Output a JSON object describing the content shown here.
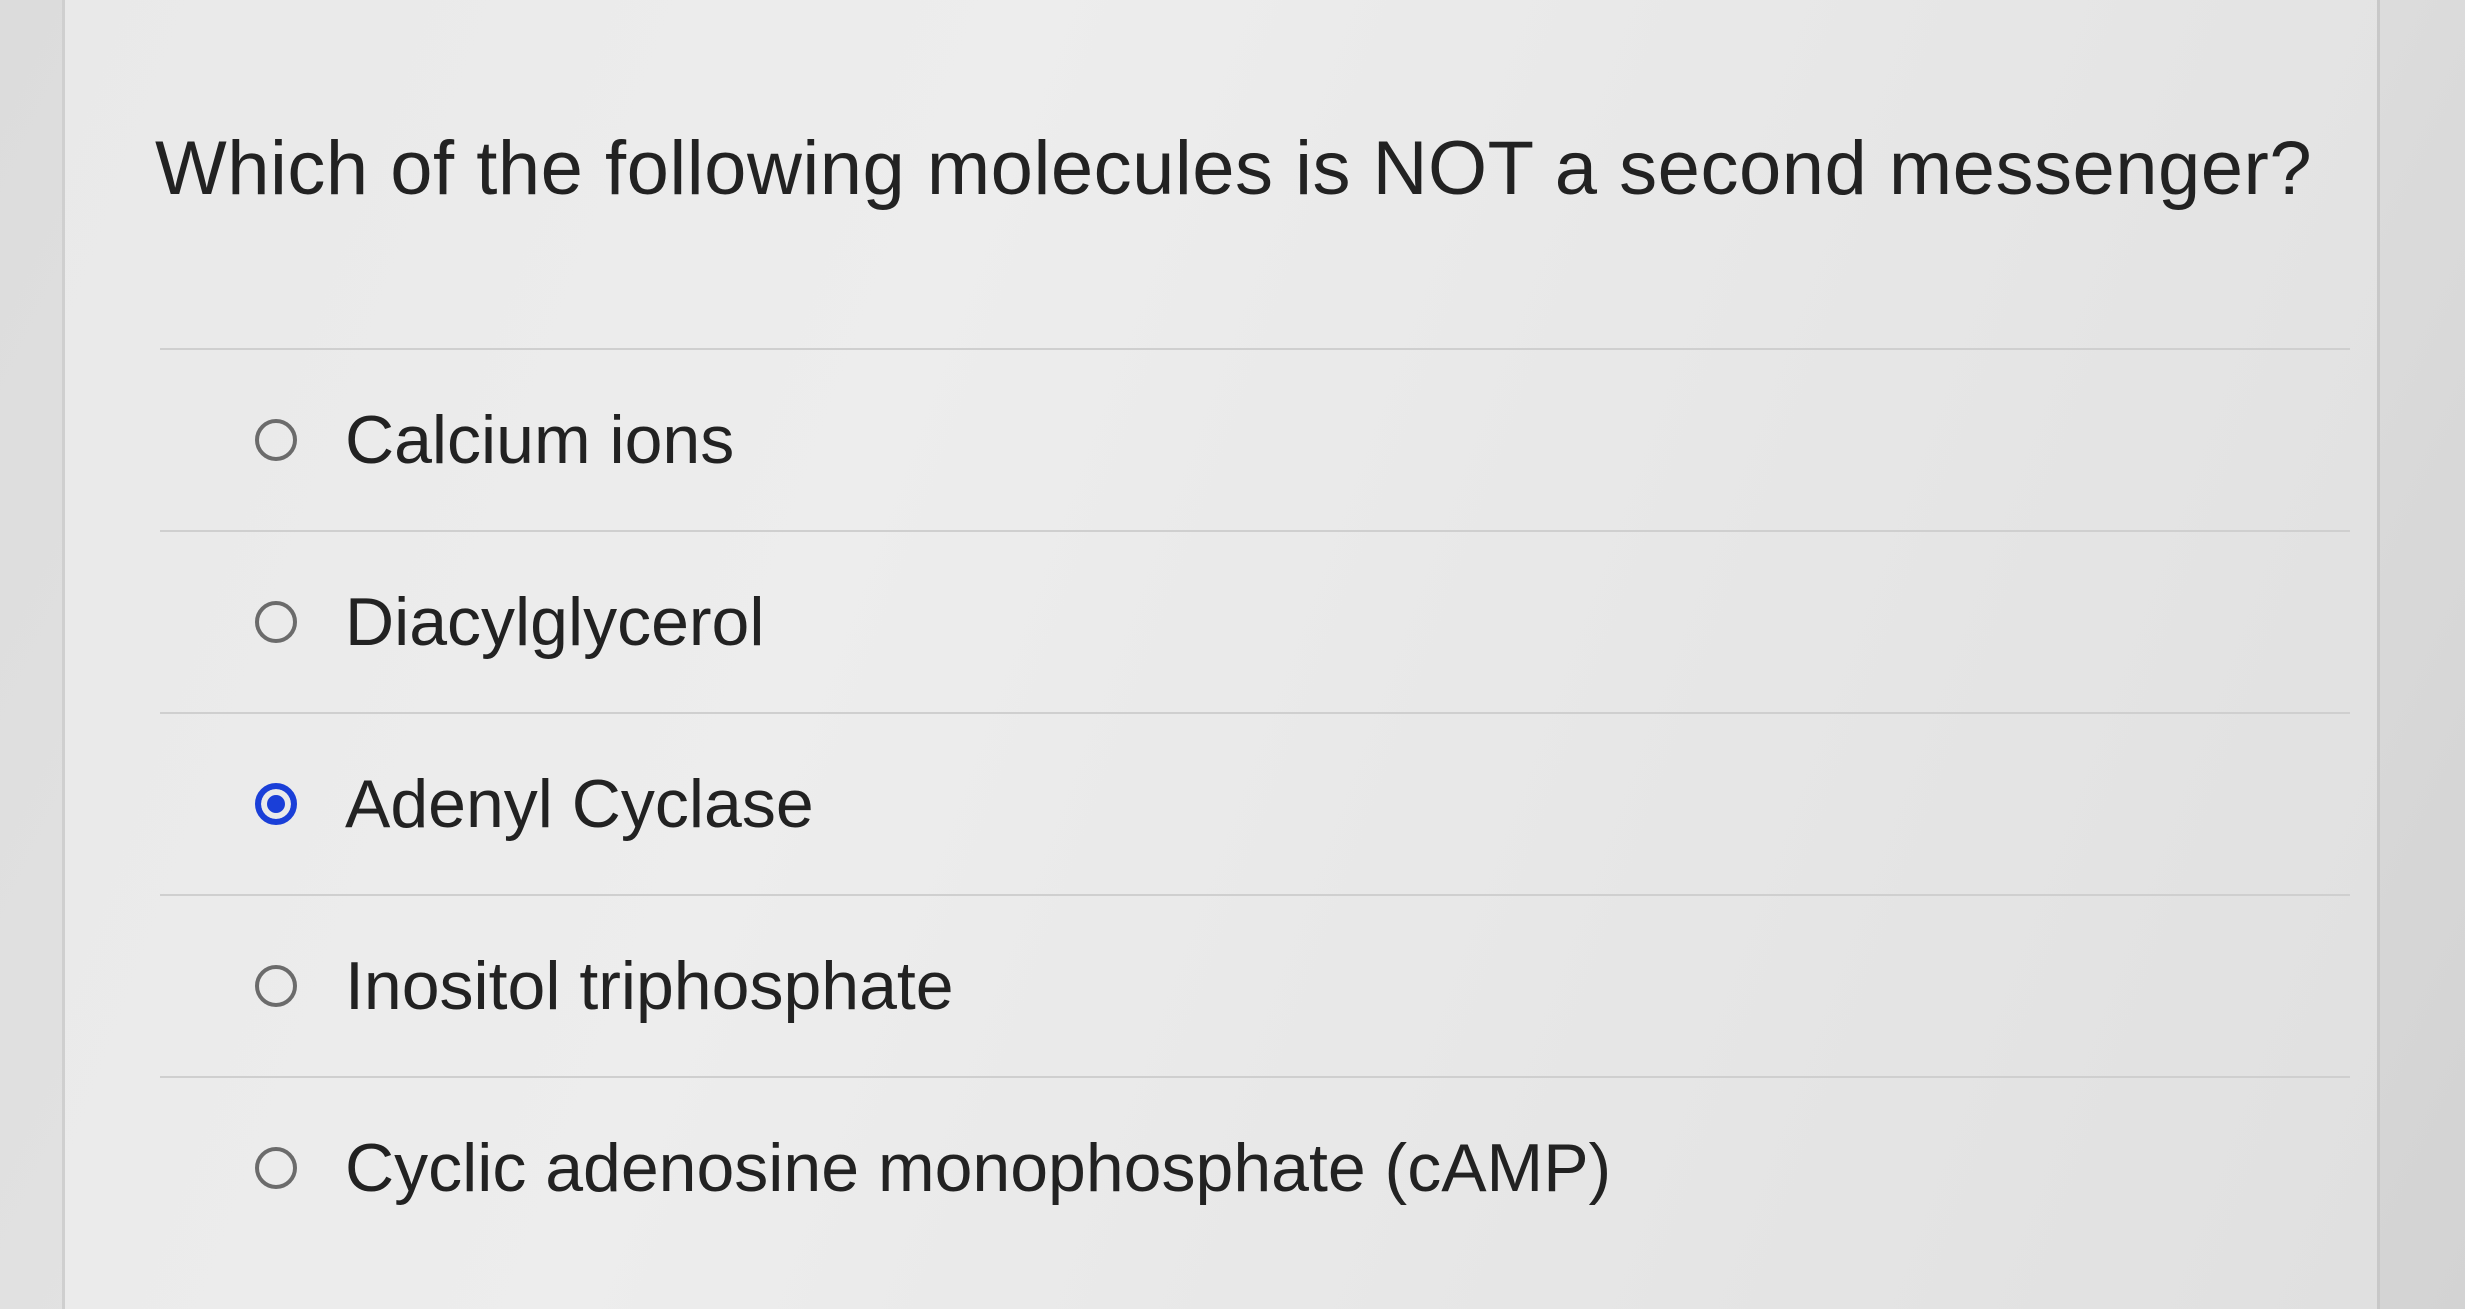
{
  "question": {
    "text": "Which of the following molecules is NOT a second messenger?"
  },
  "options": [
    {
      "label": "Calcium ions",
      "selected": false
    },
    {
      "label": "Diacylglycerol",
      "selected": false
    },
    {
      "label": "Adenyl Cyclase",
      "selected": true
    },
    {
      "label": "Inositol triphosphate",
      "selected": false
    },
    {
      "label": "Cyclic adenosine monophosphate (cAMP)",
      "selected": false
    }
  ],
  "colors": {
    "accent": "#1a3fd8",
    "text": "#222222",
    "divider": "#cfcfcf"
  }
}
